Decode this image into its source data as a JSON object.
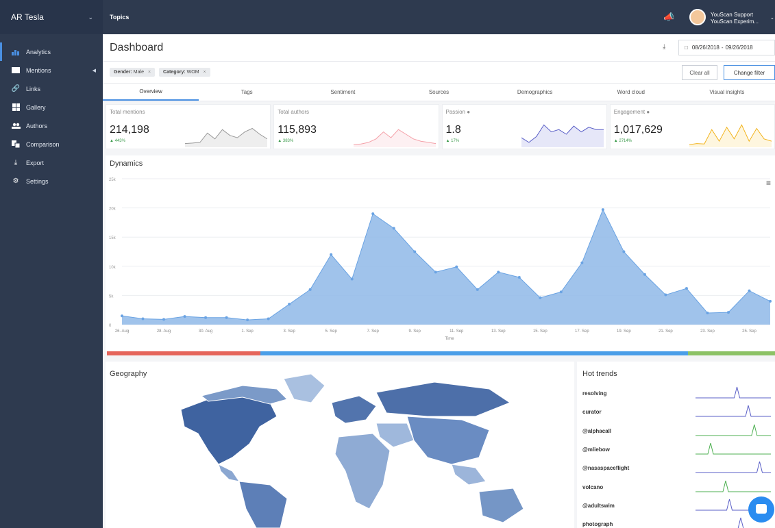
{
  "sidebar": {
    "project": "AR Tesla",
    "items": [
      {
        "label": "Analytics",
        "icon": "bar-chart-icon"
      },
      {
        "label": "Mentions",
        "icon": "envelope-icon"
      },
      {
        "label": "Links",
        "icon": "link-icon"
      },
      {
        "label": "Gallery",
        "icon": "grid-icon"
      },
      {
        "label": "Authors",
        "icon": "users-icon"
      },
      {
        "label": "Comparison",
        "icon": "compare-icon"
      },
      {
        "label": "Export",
        "icon": "download-icon"
      },
      {
        "label": "Settings",
        "icon": "gear-icon"
      }
    ]
  },
  "topbar": {
    "section": "Topics",
    "user_name": "YouScan Support",
    "user_org": "YouScan Experim..."
  },
  "dashboard": {
    "title": "Dashboard",
    "date_from": "08/26/2018",
    "date_sep": "-",
    "date_to": "09/26/2018"
  },
  "filters": {
    "chips": [
      {
        "key": "Gender:",
        "value": "Male"
      },
      {
        "key": "Category:",
        "value": "WOM"
      }
    ],
    "clear_label": "Clear all",
    "change_label": "Change filter"
  },
  "tabs": [
    "Overview",
    "Tags",
    "Sentiment",
    "Sources",
    "Demographics",
    "Word cloud",
    "Visual insights"
  ],
  "cards": [
    {
      "label": "Total mentions",
      "value": "214,198",
      "delta": "443%",
      "color": "#999999",
      "fill": "#eeeeee"
    },
    {
      "label": "Total authors",
      "value": "115,893",
      "delta": "383%",
      "color": "#f4a0a8",
      "fill": "#fdf0f2"
    },
    {
      "label": "Passion",
      "value": "1.8",
      "delta": "17%",
      "color": "#5a5fc7",
      "fill": "#e6e7f8"
    },
    {
      "label": "Engagement",
      "value": "1,017,629",
      "delta": "2714%",
      "color": "#f2b31b",
      "fill": "#fef6df"
    }
  ],
  "dynamics": {
    "title": "Dynamics",
    "xlabel": "Time"
  },
  "chart_data": {
    "type": "area",
    "x": [
      "26. Aug",
      "27. Aug",
      "28. Aug",
      "29. Aug",
      "30. Aug",
      "31. Aug",
      "1. Sep",
      "2. Sep",
      "3. Sep",
      "4. Sep",
      "5. Sep",
      "6. Sep",
      "7. Sep",
      "8. Sep",
      "9. Sep",
      "10. Sep",
      "11. Sep",
      "12. Sep",
      "13. Sep",
      "14. Sep",
      "15. Sep",
      "16. Sep",
      "17. Sep",
      "18. Sep",
      "19. Sep",
      "20. Sep",
      "21. Sep",
      "22. Sep",
      "23. Sep",
      "24. Sep",
      "25. Sep",
      "26. Sep"
    ],
    "values": [
      1500,
      1000,
      900,
      1400,
      1200,
      1200,
      800,
      1000,
      3500,
      6000,
      12000,
      7800,
      19000,
      16500,
      12500,
      9000,
      9900,
      6000,
      9000,
      8100,
      4600,
      5600,
      10600,
      19700,
      12500,
      8600,
      5100,
      6200,
      2000,
      2100,
      5800,
      4000
    ],
    "xticks": [
      "26. Aug",
      "28. Aug",
      "30. Aug",
      "1. Sep",
      "3. Sep",
      "5. Sep",
      "7. Sep",
      "9. Sep",
      "11. Sep",
      "13. Sep",
      "15. Sep",
      "17. Sep",
      "19. Sep",
      "21. Sep",
      "23. Sep",
      "25. Sep"
    ],
    "yticks": [
      "0",
      "5k",
      "10k",
      "15k",
      "20k",
      "25k"
    ],
    "ylim": [
      0,
      25000
    ],
    "xlabel": "Time",
    "color": "#8fb8e8"
  },
  "sentiment": [
    {
      "share": 0.23,
      "color": "#e5655b"
    },
    {
      "share": 0.64,
      "color": "#4a9ee8"
    },
    {
      "share": 0.13,
      "color": "#8cc265"
    }
  ],
  "geography": {
    "title": "Geography"
  },
  "hot_trends": {
    "title": "Hot trends",
    "items": [
      {
        "label": "resolving",
        "color": "#5a5fc7",
        "peak": 0.55
      },
      {
        "label": "curator",
        "color": "#5a5fc7",
        "peak": 0.7
      },
      {
        "label": "@alphacall",
        "color": "#4caf50",
        "peak": 0.78
      },
      {
        "label": "@mliebow",
        "color": "#4caf50",
        "peak": 0.2
      },
      {
        "label": "@nasaspaceflight",
        "color": "#5a5fc7",
        "peak": 0.85
      },
      {
        "label": "volcano",
        "color": "#4caf50",
        "peak": 0.4
      },
      {
        "label": "@adultswim",
        "color": "#5a5fc7",
        "peak": 0.45
      },
      {
        "label": "photograph",
        "color": "#5a5fc7",
        "peak": 0.6
      }
    ]
  }
}
